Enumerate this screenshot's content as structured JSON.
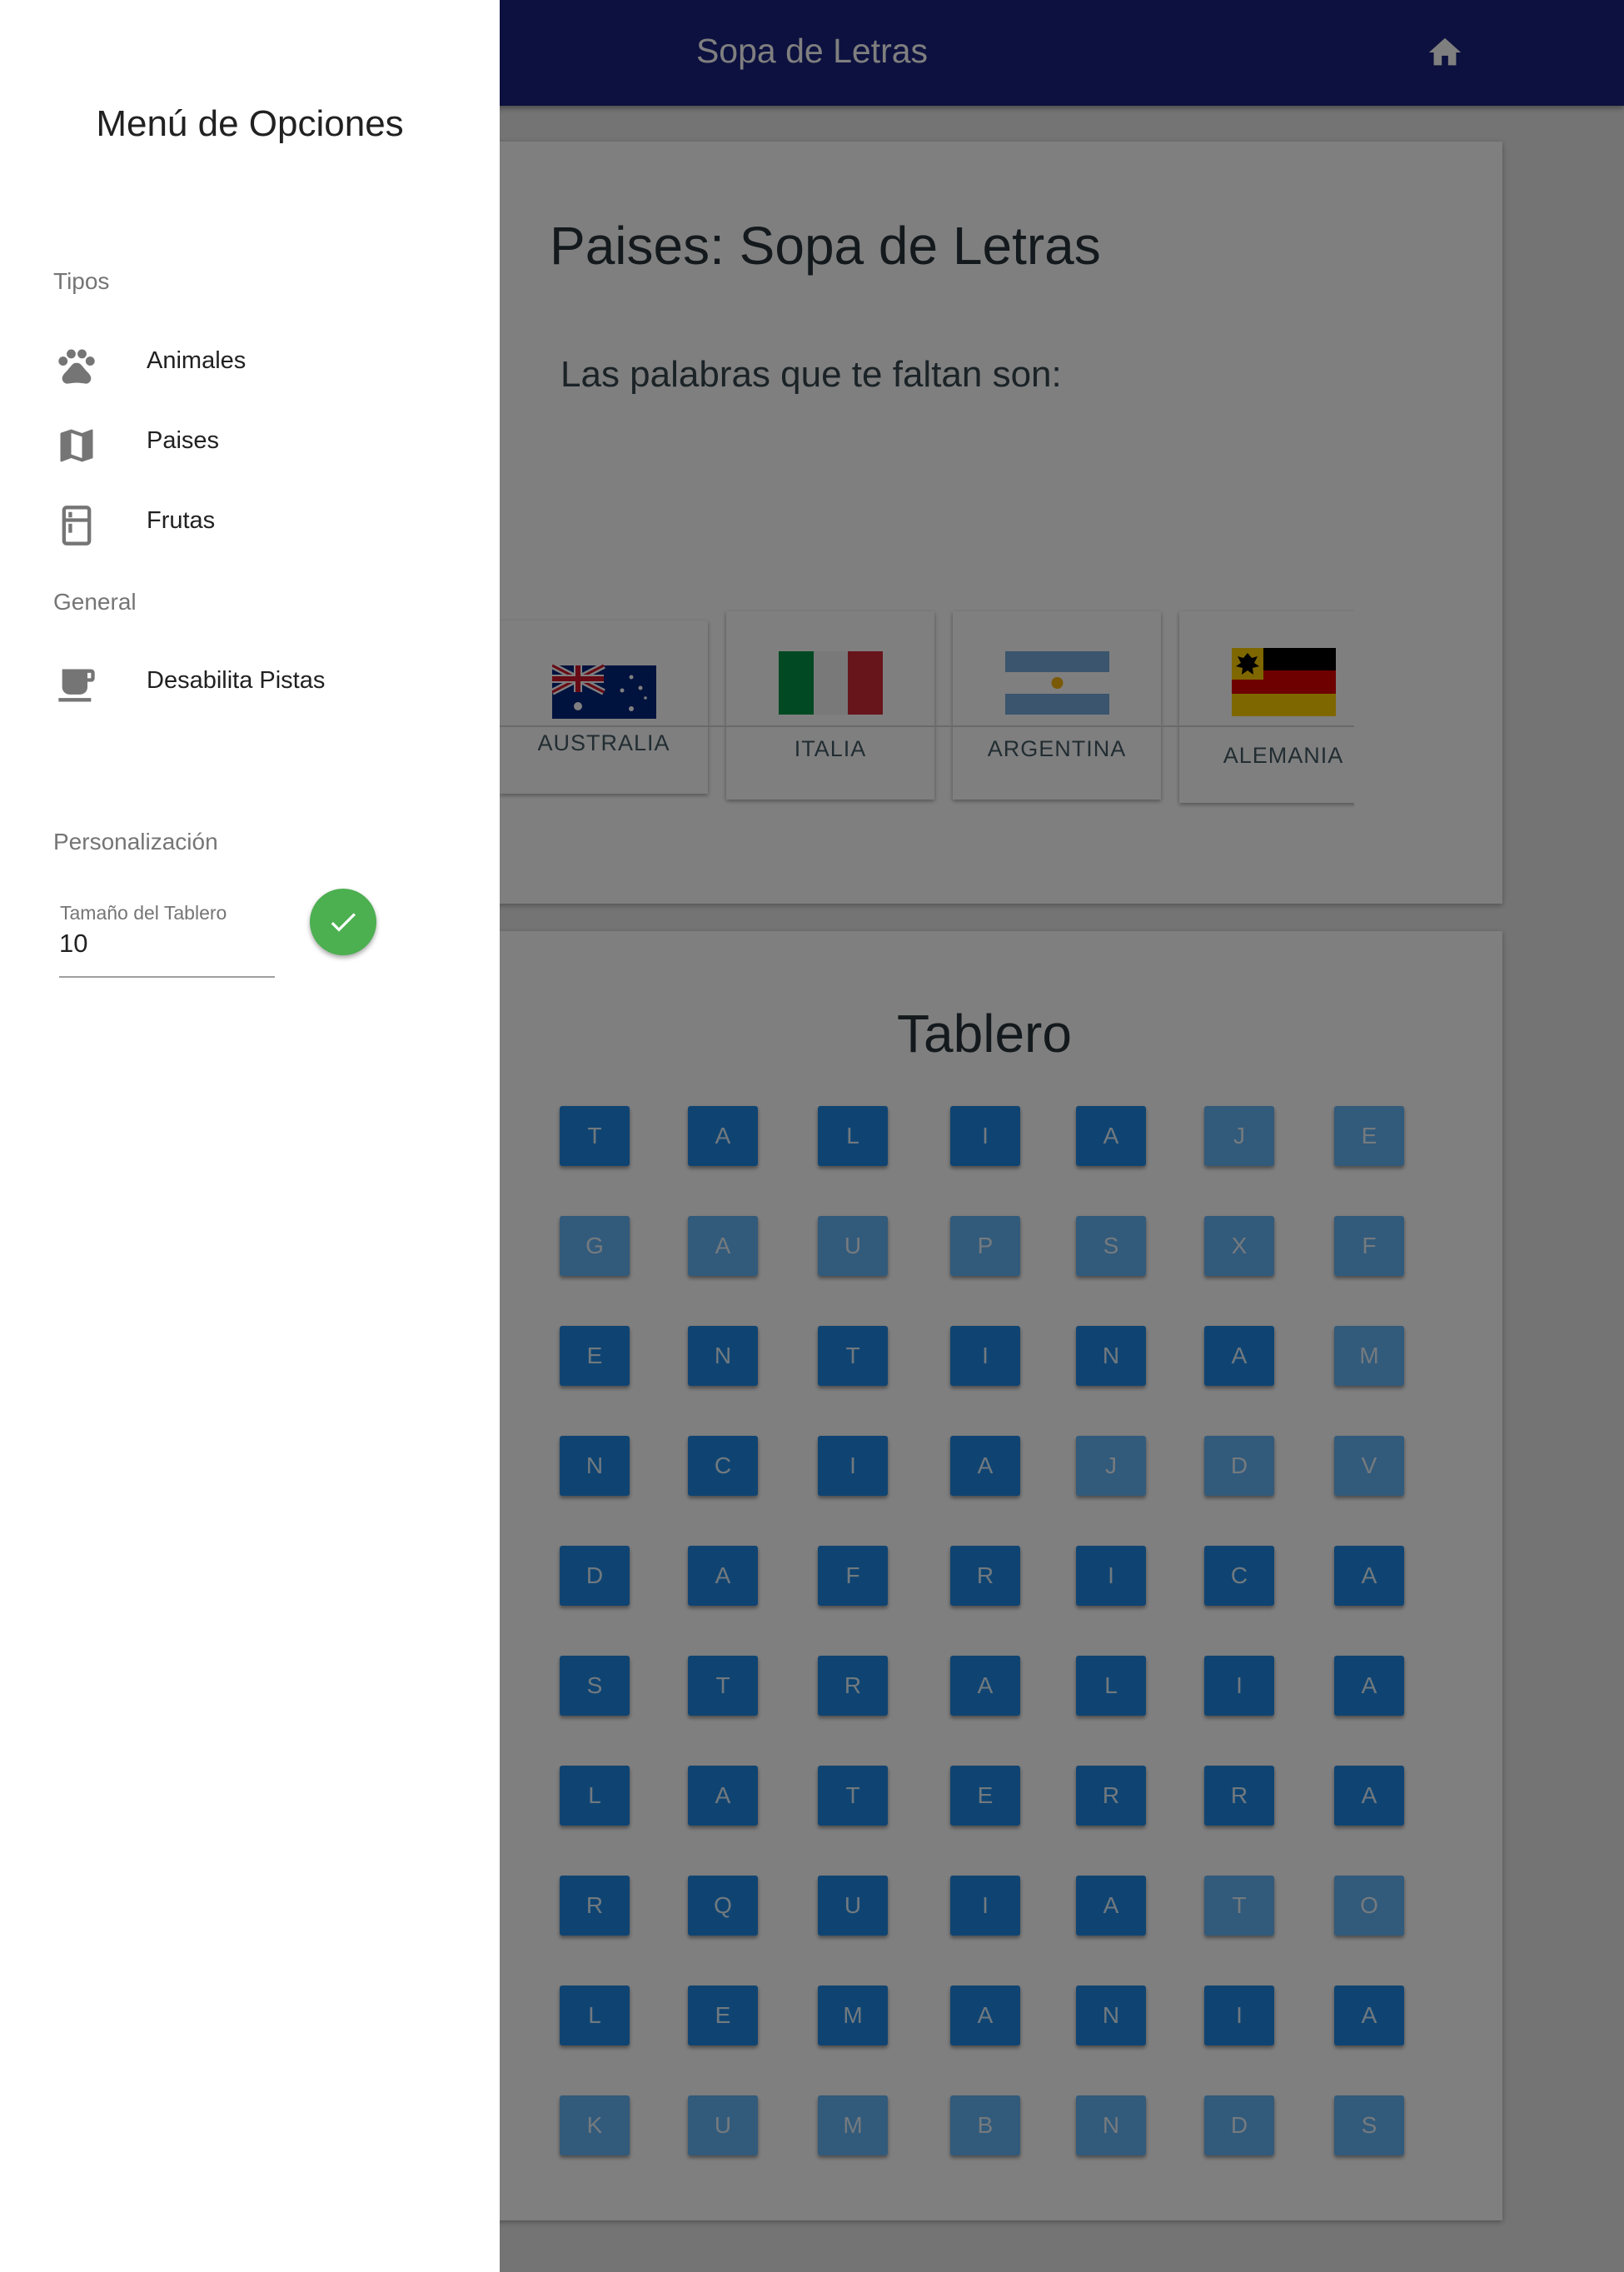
{
  "app": {
    "title": "Sopa de Letras"
  },
  "words_card": {
    "title": "Paises: Sopa de Letras",
    "subtitle": "Las palabras que te faltan son:",
    "words": [
      {
        "name": "AUSTRALIA",
        "flag": "australia-flag"
      },
      {
        "name": "ITALIA",
        "flag": "italy-flag"
      },
      {
        "name": "ARGENTINA",
        "flag": "argentina-flag"
      },
      {
        "name": "ALEMANIA",
        "flag": "germany-imperial-flag"
      }
    ]
  },
  "board": {
    "title": "Tablero",
    "rows": [
      [
        "T",
        "A",
        "L",
        "I",
        "A",
        "J",
        "E"
      ],
      [
        "G",
        "A",
        "U",
        "P",
        "S",
        "X",
        "F"
      ],
      [
        "E",
        "N",
        "T",
        "I",
        "N",
        "A",
        "M"
      ],
      [
        "N",
        "C",
        "I",
        "A",
        "J",
        "D",
        "V"
      ],
      [
        "D",
        "A",
        "F",
        "R",
        "I",
        "C",
        "A"
      ],
      [
        "S",
        "T",
        "R",
        "A",
        "L",
        "I",
        "A"
      ],
      [
        "L",
        "A",
        "T",
        "E",
        "R",
        "R",
        "A"
      ],
      [
        "R",
        "Q",
        "U",
        "I",
        "A",
        "T",
        "O"
      ],
      [
        "L",
        "E",
        "M",
        "A",
        "N",
        "I",
        "A"
      ],
      [
        "K",
        "U",
        "M",
        "B",
        "N",
        "D",
        "S"
      ]
    ],
    "highlighted": [
      [
        1,
        1,
        1,
        1,
        1,
        0,
        0
      ],
      [
        0,
        0,
        0,
        0,
        0,
        0,
        0
      ],
      [
        1,
        1,
        1,
        1,
        1,
        1,
        0
      ],
      [
        1,
        1,
        1,
        1,
        0,
        0,
        0
      ],
      [
        1,
        1,
        1,
        1,
        1,
        1,
        1
      ],
      [
        1,
        1,
        1,
        1,
        1,
        1,
        1
      ],
      [
        1,
        1,
        1,
        1,
        1,
        1,
        1
      ],
      [
        1,
        1,
        1,
        1,
        1,
        0,
        0
      ],
      [
        1,
        1,
        1,
        1,
        1,
        1,
        1
      ],
      [
        0,
        0,
        0,
        0,
        0,
        0,
        0
      ]
    ]
  },
  "drawer": {
    "title": "Menú de Opciones",
    "sections": {
      "types": "Tipos",
      "general": "General",
      "custom": "Personalización"
    },
    "items": [
      {
        "label": "Animales",
        "icon": "paw-icon"
      },
      {
        "label": "Paises",
        "icon": "map-icon"
      },
      {
        "label": "Frutas",
        "icon": "fridge-icon"
      },
      {
        "label": "Desabilita Pistas",
        "icon": "coffee-icon"
      }
    ],
    "board_size": {
      "label": "Tamaño del Tablero",
      "value": "10"
    }
  },
  "colors": {
    "appbar": "#1a237e",
    "cell": "#1e88e5",
    "cell_light": "#64b5f6",
    "confirm": "#4caf50"
  }
}
